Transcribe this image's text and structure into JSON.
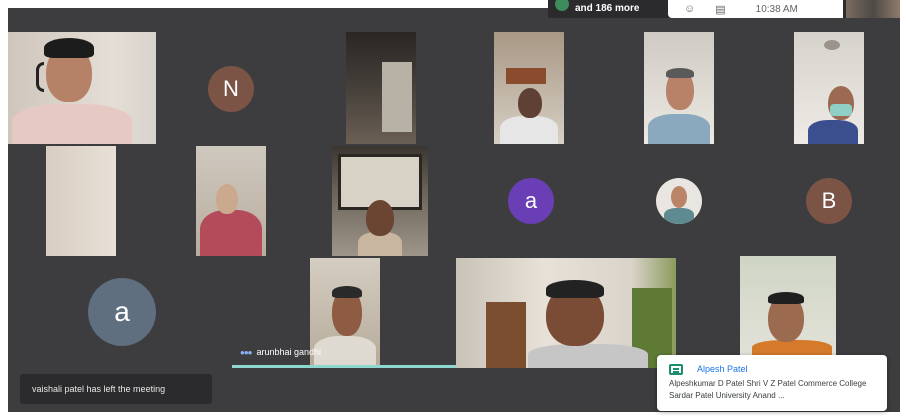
{
  "header": {
    "more_participants": "and 186 more",
    "time": "10:38 AM"
  },
  "avatars": {
    "n": "N",
    "a_purple": "a",
    "b": "B",
    "a_large": "a"
  },
  "active_speaker": {
    "name": "arunbhai gandhi"
  },
  "notifications": {
    "left_meeting": "vaishali patel has left the meeting"
  },
  "chat": {
    "sender": "Alpesh Patel",
    "message": "Alpeshkumar D Patel Shri V Z Patel Commerce College Sardar Patel University Anand ..."
  },
  "colors": {
    "stage": "#3d3d3f",
    "avatar_n": "#7b5446",
    "avatar_a_purple": "#6a3fb5",
    "avatar_b": "#7b5446",
    "avatar_a_large": "#5f6f7f",
    "speaking": "#8fd6cf",
    "chat_accent": "#1a8f6f",
    "sender": "#1a73e8"
  }
}
